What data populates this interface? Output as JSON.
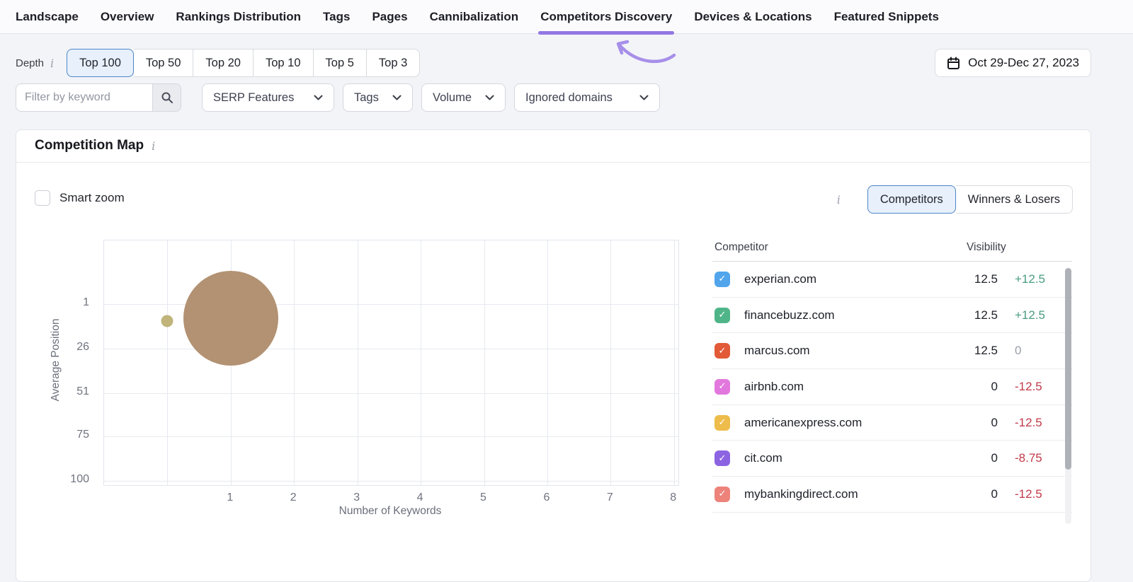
{
  "nav": {
    "tabs": [
      {
        "label": "Landscape",
        "active": false
      },
      {
        "label": "Overview",
        "active": false
      },
      {
        "label": "Rankings Distribution",
        "active": false
      },
      {
        "label": "Tags",
        "active": false
      },
      {
        "label": "Pages",
        "active": false
      },
      {
        "label": "Cannibalization",
        "active": false
      },
      {
        "label": "Competitors Discovery",
        "active": true
      },
      {
        "label": "Devices & Locations",
        "active": false
      },
      {
        "label": "Featured Snippets",
        "active": false
      }
    ],
    "accent_color": "#9277e2",
    "arrow_color": "#a78fe9"
  },
  "toolbar": {
    "depth_label": "Depth",
    "depth_options": [
      {
        "label": "Top 100",
        "selected": true
      },
      {
        "label": "Top 50",
        "selected": false
      },
      {
        "label": "Top 20",
        "selected": false
      },
      {
        "label": "Top 10",
        "selected": false
      },
      {
        "label": "Top 5",
        "selected": false
      },
      {
        "label": "Top 3",
        "selected": false
      }
    ],
    "date_range": "Oct 29-Dec 27, 2023"
  },
  "filters": {
    "keyword_placeholder": "Filter by keyword",
    "dropdowns": [
      "SERP Features",
      "Tags",
      "Volume",
      "Ignored domains"
    ]
  },
  "card": {
    "title": "Competition Map",
    "smart_zoom_label": "Smart zoom",
    "view_toggle": [
      {
        "label": "Competitors",
        "selected": true
      },
      {
        "label": "Winners & Losers",
        "selected": false
      }
    ]
  },
  "chart_data": {
    "type": "bubble",
    "xlabel": "Number of Keywords",
    "ylabel": "Average Position",
    "x_ticks": [
      1,
      2,
      3,
      4,
      5,
      6,
      7,
      8
    ],
    "y_ticks": [
      1,
      26,
      51,
      75,
      100
    ],
    "grid_x": [
      0,
      1,
      2,
      3,
      4,
      5,
      6,
      7,
      8
    ],
    "xlim": [
      -1,
      8.07
    ],
    "ylim": [
      -34.4,
      102.4
    ],
    "y_axis_inverted": true,
    "grid": true,
    "points": [
      {
        "x": 1,
        "y": 9,
        "radius_px": 67,
        "color": "#b29273"
      },
      {
        "x": 0,
        "y": 10.5,
        "radius_px": 8.5,
        "color": "#c0b47b"
      }
    ]
  },
  "table": {
    "columns": [
      "Competitor",
      "Visibility"
    ],
    "rows": [
      {
        "domain": "experian.com",
        "checkbox_color": "#52a5eb",
        "checked": true,
        "visibility": "12.5",
        "diff": "+12.5",
        "diff_type": "up"
      },
      {
        "domain": "financebuzz.com",
        "checkbox_color": "#4fb588",
        "checked": true,
        "visibility": "12.5",
        "diff": "+12.5",
        "diff_type": "up"
      },
      {
        "domain": "marcus.com",
        "checkbox_color": "#e25a38",
        "checked": true,
        "visibility": "12.5",
        "diff": "0",
        "diff_type": "zero"
      },
      {
        "domain": "airbnb.com",
        "checkbox_color": "#e278dd",
        "checked": true,
        "visibility": "0",
        "diff": "-12.5",
        "diff_type": "down"
      },
      {
        "domain": "americanexpress.com",
        "checkbox_color": "#edbc4a",
        "checked": true,
        "visibility": "0",
        "diff": "-12.5",
        "diff_type": "down"
      },
      {
        "domain": "cit.com",
        "checkbox_color": "#8c64e2",
        "checked": true,
        "visibility": "0",
        "diff": "-8.75",
        "diff_type": "down"
      },
      {
        "domain": "mybankingdirect.com",
        "checkbox_color": "#ed837b",
        "checked": true,
        "visibility": "0",
        "diff": "-12.5",
        "diff_type": "down"
      }
    ]
  }
}
